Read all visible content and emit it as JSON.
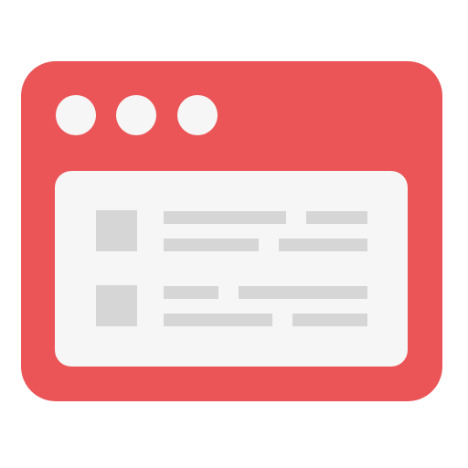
{
  "icon": {
    "name": "browser-window-icon",
    "colors": {
      "frame": "#EB5557",
      "dots": "#F6F6F6",
      "content": "#F6F6F6",
      "placeholder": "#D6D6D6",
      "background": "#FFFFFF"
    },
    "window_dot_count": 3,
    "content_item_count": 2,
    "text_lines_per_item": 2
  }
}
